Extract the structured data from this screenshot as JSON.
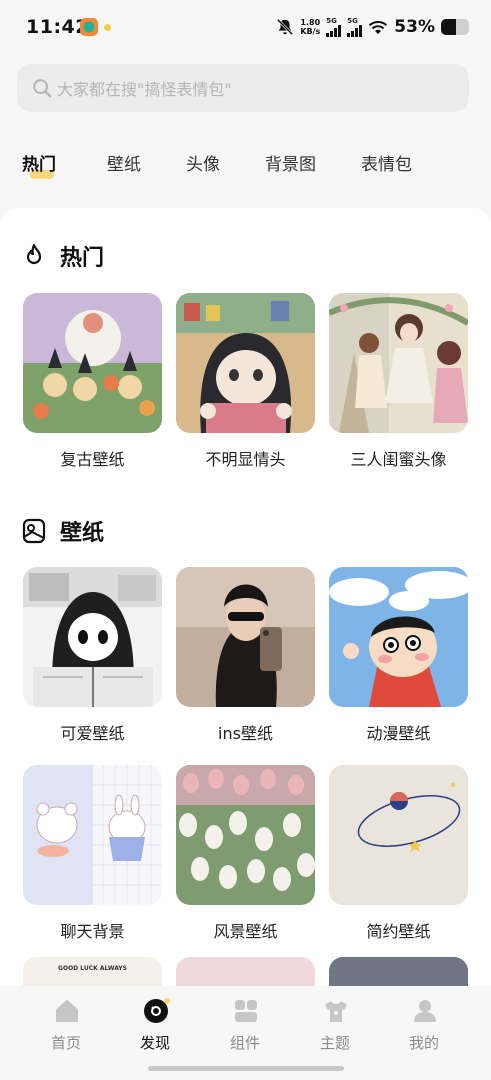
{
  "status_bar": {
    "time": "11:42",
    "net_speed_value": "1.80",
    "net_speed_unit": "KB/s",
    "sim1_label": "5G",
    "sim2_label": "5G",
    "battery_text": "53%",
    "battery_level": 0.53
  },
  "search": {
    "placeholder": "大家都在搜\"搞怪表情包\""
  },
  "category_tabs": [
    {
      "label": "热门",
      "active": true
    },
    {
      "label": "壁纸"
    },
    {
      "label": "头像"
    },
    {
      "label": "背景图"
    },
    {
      "label": "表情包"
    }
  ],
  "sections": [
    {
      "title": "热门",
      "icon": "flame-icon",
      "items": [
        {
          "caption": "复古壁纸"
        },
        {
          "caption": "不明显情头"
        },
        {
          "caption": "三人闺蜜头像"
        }
      ]
    },
    {
      "title": "壁纸",
      "icon": "wallpaper-icon",
      "items": [
        {
          "caption": "可爱壁纸"
        },
        {
          "caption": "ins壁纸"
        },
        {
          "caption": "动漫壁纸"
        },
        {
          "caption": "聊天背景"
        },
        {
          "caption": "风景壁纸"
        },
        {
          "caption": "简约壁纸"
        }
      ]
    }
  ],
  "peek_thumb_text": "GOOD LUCK ALWAYS",
  "bottom_nav": [
    {
      "label": "首页",
      "icon": "home-icon"
    },
    {
      "label": "发现",
      "icon": "discover-icon",
      "active": true
    },
    {
      "label": "组件",
      "icon": "widgets-icon"
    },
    {
      "label": "主题",
      "icon": "theme-shirt-icon"
    },
    {
      "label": "我的",
      "icon": "profile-icon"
    }
  ],
  "colors": {
    "accent_yellow": "#ffd166",
    "page_bg": "#f6f6f6",
    "card_bg": "#ffffff"
  }
}
